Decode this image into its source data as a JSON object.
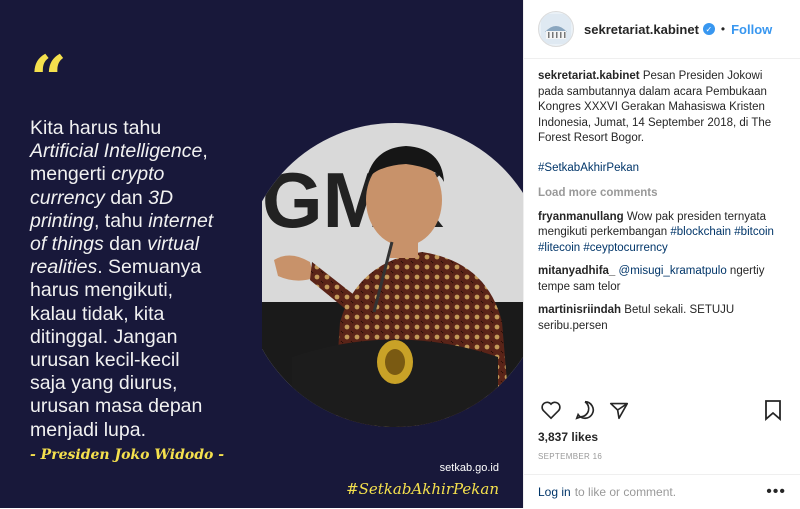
{
  "image": {
    "quote_mark": "“",
    "quote_lines": [
      [
        {
          "t": "Kita harus tahu",
          "i": false
        }
      ],
      [
        {
          "t": "Artificial Intelligence",
          "i": true
        },
        {
          "t": ",",
          "i": false
        }
      ],
      [
        {
          "t": "mengerti ",
          "i": false
        },
        {
          "t": "crypto",
          "i": true
        }
      ],
      [
        {
          "t": "currency",
          "i": true
        },
        {
          "t": " dan ",
          "i": false
        },
        {
          "t": "3D",
          "i": true
        }
      ],
      [
        {
          "t": "printing",
          "i": true
        },
        {
          "t": ", tahu ",
          "i": false
        },
        {
          "t": "internet",
          "i": true
        }
      ],
      [
        {
          "t": "of things",
          "i": true
        },
        {
          "t": " dan ",
          "i": false
        },
        {
          "t": "virtual",
          "i": true
        }
      ],
      [
        {
          "t": "realities",
          "i": true
        },
        {
          "t": ". Semuanya",
          "i": false
        }
      ],
      [
        {
          "t": "harus mengikuti,",
          "i": false
        }
      ],
      [
        {
          "t": "kalau tidak, kita",
          "i": false
        }
      ],
      [
        {
          "t": "ditinggal. Jangan",
          "i": false
        }
      ],
      [
        {
          "t": "urusan kecil-kecil",
          "i": false
        }
      ],
      [
        {
          "t": "saja yang diurus,",
          "i": false
        }
      ],
      [
        {
          "t": "urusan masa depan",
          "i": false
        }
      ],
      [
        {
          "t": "menjadi lupa.",
          "i": false
        }
      ]
    ],
    "author": "- Presiden Joko Widodo -",
    "site": "setkab.go.id",
    "hashtag": "#SetkabAkhirPekan",
    "backdrop_text": "GMK",
    "colors": {
      "background": "#18183a",
      "accent": "#f4e04d"
    }
  },
  "header": {
    "username": "sekretariat.kabinet",
    "verified_icon": "verified-badge-icon",
    "separator": "•",
    "follow_label": "Follow"
  },
  "caption": {
    "username": "sekretariat.kabinet",
    "text": "Pesan Presiden Jokowi pada sambutannya dalam acara Pembukaan Kongres XXXVI Gerakan Mahasiswa Kristen Indonesia, Jumat, 14 September 2018, di The Forest Resort Bogor.",
    "hashtag": "#SetkabAkhirPekan"
  },
  "load_more": "Load more comments",
  "comments": [
    {
      "user": "fryanmanullang",
      "parts": [
        {
          "t": "Wow pak presiden ternyata mengikuti perkembangan ",
          "link": false
        },
        {
          "t": "#blockchain",
          "link": true
        },
        {
          "t": " ",
          "link": false
        },
        {
          "t": "#bitcoin",
          "link": true
        },
        {
          "t": " ",
          "link": false
        },
        {
          "t": "#litecoin",
          "link": true
        },
        {
          "t": " ",
          "link": false
        },
        {
          "t": "#ceyptocurrency",
          "link": true
        }
      ]
    },
    {
      "user": "mitanyadhifa_",
      "parts": [
        {
          "t": "@misugi_kramatpulo",
          "link": true
        },
        {
          "t": " ngertiy tempe sam telor",
          "link": false
        }
      ]
    },
    {
      "user": "martinisriindah",
      "parts": [
        {
          "t": "Betul sekali. SETUJU seribu.persen",
          "link": false
        }
      ]
    }
  ],
  "actions": {
    "like_icon": "heart-icon",
    "comment_icon": "comment-icon",
    "share_icon": "share-icon",
    "save_icon": "bookmark-icon"
  },
  "likes": "3,837 likes",
  "date": "SEPTEMBER 16",
  "footer": {
    "login": "Log in",
    "text": "to like or comment.",
    "more_icon": "•••"
  },
  "colors": {
    "link": "#003569",
    "follow": "#3897f0",
    "muted": "#999999"
  }
}
